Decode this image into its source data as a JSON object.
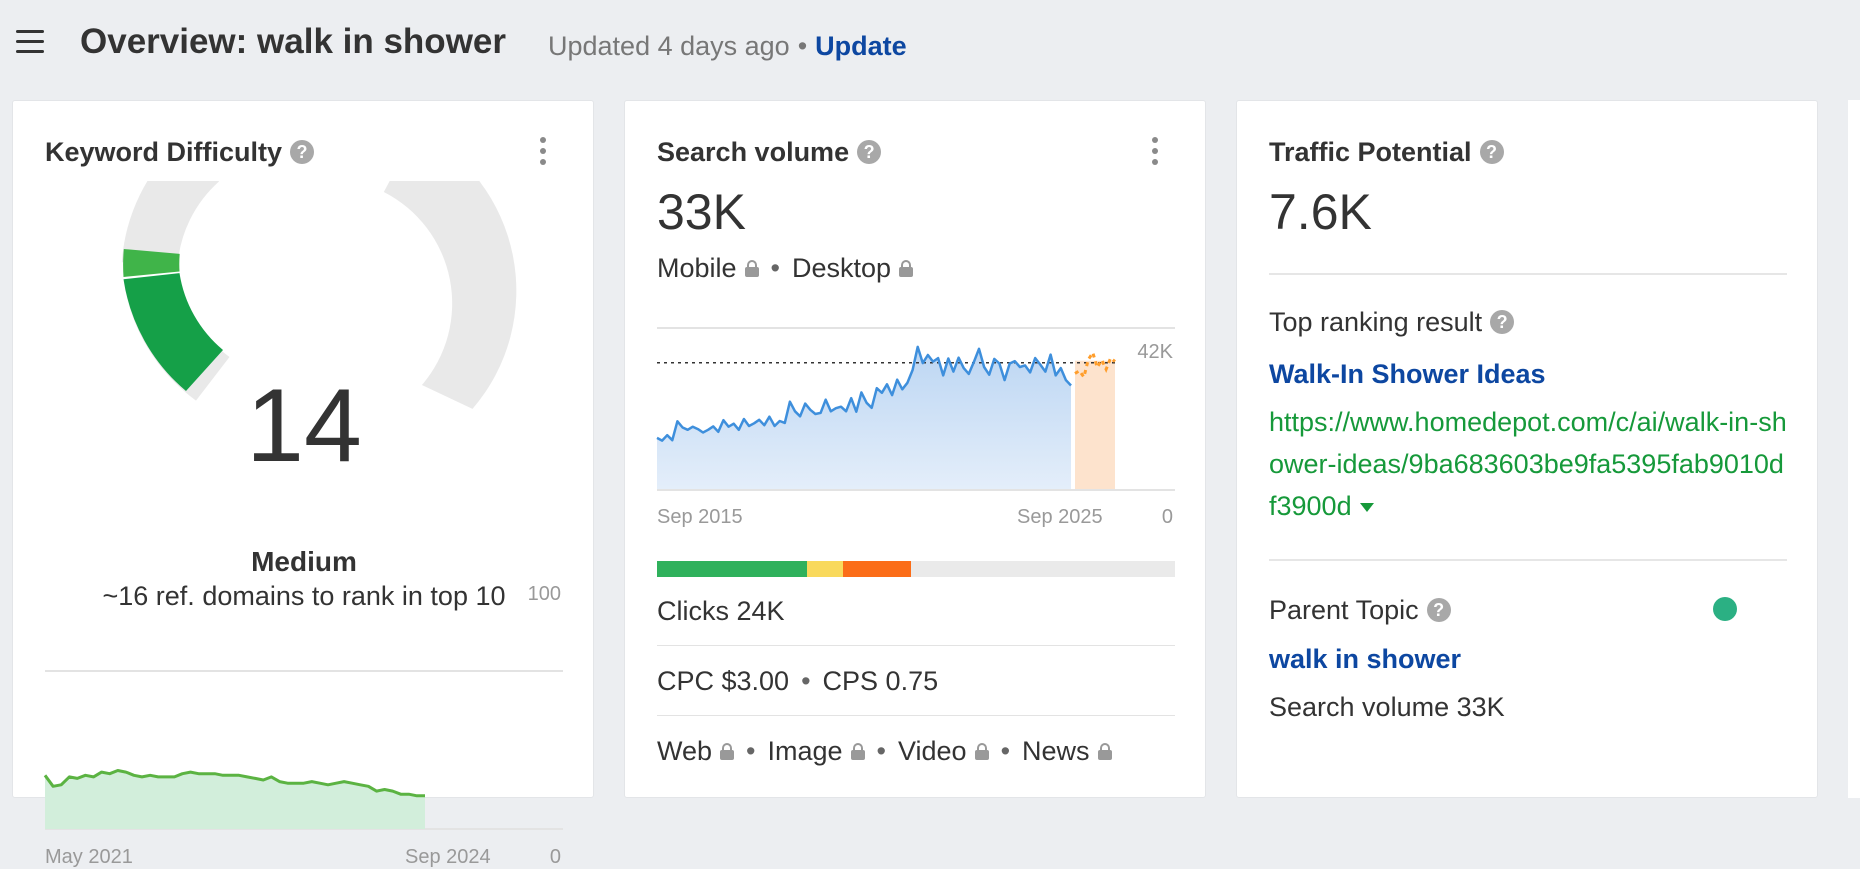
{
  "header": {
    "title": "Overview: walk in shower",
    "updated": "Updated 4 days ago",
    "separator": "•",
    "update_link": "Update"
  },
  "keyword_difficulty": {
    "title": "Keyword Difficulty",
    "score": "14",
    "rating": "Medium",
    "description": "~16 ref. domains to rank in top 10",
    "chart": {
      "y_max_label": "100",
      "y_min_label": "0",
      "x_start_label": "May 2021",
      "x_end_label": "Sep 2024"
    }
  },
  "search_volume": {
    "title": "Search volume",
    "value": "33K",
    "device_mobile": "Mobile",
    "device_desktop": "Desktop",
    "chart": {
      "y_max_label": "42K",
      "y_min_label": "0",
      "x_start_label": "Sep 2015",
      "x_end_label": "Sep 2025"
    },
    "clicks": "Clicks 24K",
    "cpc": "CPC $3.00",
    "cps": "CPS 0.75",
    "sources": [
      "Web",
      "Image",
      "Video",
      "News"
    ]
  },
  "traffic_potential": {
    "title": "Traffic Potential",
    "value": "7.6K",
    "top_result_label": "Top ranking result",
    "top_result_title": "Walk-In Shower Ideas",
    "top_result_url": "https://www.homedepot.com/c/ai/walk-in-shower-ideas/9ba683603be9fa5395fab9010df3900d",
    "parent_topic_label": "Parent Topic",
    "parent_topic": "walk in shower",
    "parent_topic_volume": "Search volume 33K"
  },
  "chart_data": [
    {
      "type": "area",
      "title": "Keyword Difficulty",
      "x_start": "May 2021",
      "x_end": "Sep 2024",
      "ylim": [
        0,
        100
      ],
      "values": [
        34,
        27,
        28,
        33,
        32,
        34,
        33,
        36,
        35,
        37,
        36,
        34,
        33,
        34,
        33,
        33,
        33,
        35,
        36,
        35,
        35,
        35,
        34,
        34,
        34,
        33,
        32,
        31,
        33,
        30,
        29,
        29,
        29,
        30,
        29,
        28,
        29,
        30,
        29,
        28,
        27,
        24,
        25,
        24,
        22,
        22,
        21,
        21
      ],
      "color": "#5bb342"
    },
    {
      "type": "line",
      "title": "Search volume",
      "x_start": "Sep 2015",
      "x_end": "Sep 2025",
      "ylim": [
        0,
        42000
      ],
      "reference_value": 33000,
      "values": [
        13500,
        12800,
        14200,
        12900,
        17800,
        16200,
        15600,
        16400,
        15800,
        14900,
        15600,
        16500,
        15100,
        18100,
        16400,
        17200,
        15600,
        18400,
        16600,
        17300,
        18200,
        16800,
        19000,
        16600,
        17900,
        17400,
        22900,
        20400,
        19100,
        22400,
        20800,
        19700,
        20000,
        23400,
        20400,
        21200,
        21600,
        20400,
        23800,
        20300,
        25300,
        22600,
        21300,
        26400,
        25200,
        27400,
        24600,
        28600,
        26100,
        27800,
        31100,
        37100,
        32900,
        35000,
        33300,
        34200,
        29700,
        34100,
        30700,
        34300,
        31600,
        30100,
        33200,
        36600,
        31900,
        29900,
        34000,
        32800,
        28500,
        32800,
        33400,
        31900,
        32300,
        30500,
        34200,
        32500,
        30700,
        35100,
        29700,
        31600,
        28500,
        27100
      ],
      "forecast_values": [
        30200,
        30900,
        29300,
        33800,
        35600,
        31800,
        33700,
        31300,
        34200,
        33300
      ],
      "color": "#3e8fdc",
      "forecast_color": "#ff9e2c"
    }
  ]
}
